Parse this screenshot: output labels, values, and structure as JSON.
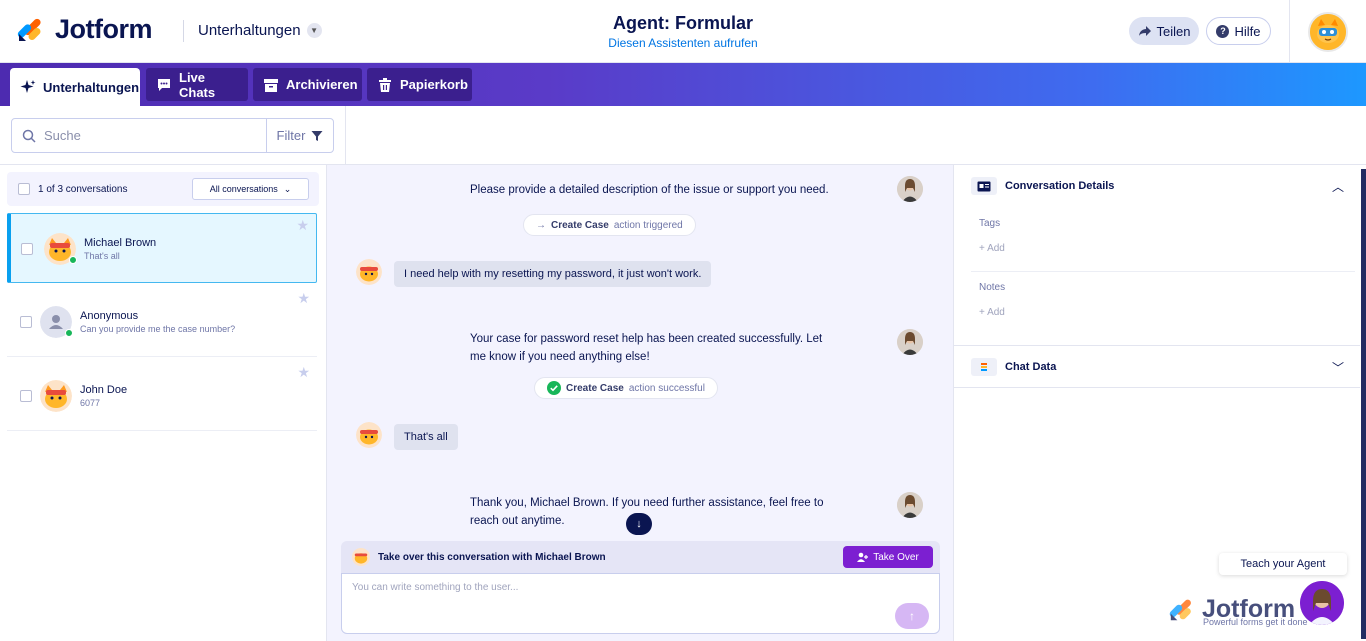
{
  "header": {
    "logo_text": "Jotform",
    "menu_label": "Unterhaltungen",
    "title": "Agent: Formular",
    "subtitle": "Diesen Assistenten aufrufen",
    "share_label": "Teilen",
    "help_label": "Hilfe"
  },
  "tabs": [
    {
      "label": "Unterhaltungen",
      "icon": "sparkle-icon",
      "active": true
    },
    {
      "label": "Live Chats",
      "icon": "chat-icon",
      "active": false
    },
    {
      "label": "Archivieren",
      "icon": "archive-icon",
      "active": false
    },
    {
      "label": "Papierkorb",
      "icon": "trash-icon",
      "active": false
    }
  ],
  "search": {
    "placeholder": "Suche",
    "filter_label": "Filter"
  },
  "list": {
    "count_label": "1 of 3 conversations",
    "filter_select": "All conversations",
    "items": [
      {
        "name": "Michael Brown",
        "snippet": "That's all",
        "online": true,
        "selected": true
      },
      {
        "name": "Anonymous",
        "snippet": "Can you provide me the case number?",
        "online": true,
        "selected": false
      },
      {
        "name": "John Doe",
        "snippet": "6077",
        "online": false,
        "selected": false
      }
    ]
  },
  "chat": {
    "messages": {
      "agent1": "Please provide a detailed description of the issue or support you need.",
      "action1_name": "Create Case",
      "action1_status": "action triggered",
      "user1": "I need help with my resetting my password, it just won't work.",
      "agent2_line1": "Your case for password reset help has been created successfully. Let",
      "agent2_line2": "me know if you need anything else!",
      "action2_name": "Create Case",
      "action2_status": "action successful",
      "user2": "That's all",
      "agent3_line1": "Thank you, Michael Brown. If you need further assistance, feel free to",
      "agent3_line2": "reach out anytime."
    },
    "takeover_prefix": "Take over this conversation with",
    "takeover_name": "Michael Brown",
    "takeover_button": "Take Over",
    "compose_placeholder": "You can write something to the user..."
  },
  "details": {
    "conv_details_title": "Conversation Details",
    "tags_label": "Tags",
    "tags_add": "+ Add",
    "notes_label": "Notes",
    "notes_add": "+ Add",
    "chat_data_title": "Chat Data",
    "teach_label": "Teach your Agent",
    "brand_text": "Jotform",
    "brand_tagline": "Powerful forms get it done"
  },
  "colors": {
    "brand_navy": "#0a1551",
    "accent_purple": "#7c1fd1",
    "selected_border": "#09a0ef",
    "online_green": "#18b659"
  }
}
